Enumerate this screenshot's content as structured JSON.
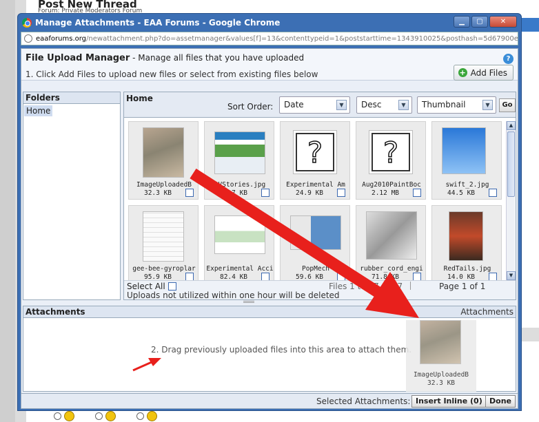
{
  "background_page": {
    "title": "Post New Thread",
    "subtitle": "Forum: Private Moderators Forum"
  },
  "window": {
    "title": "Manage Attachments - EAA Forums - Google Chrome",
    "url_host": "eaaforums.org",
    "url_path": "/newattachment.php?do=assetmanager&values[f]=13&contenttypeid=1&poststarttime=1343910025&posthash=5d67900ea59ba"
  },
  "header": {
    "title": "File Upload Manager",
    "subtitle": "- Manage all files that you have uploaded",
    "instruction": "1. Click Add Files to upload new files or select from existing files below",
    "help": "?",
    "add_files_label": "Add Files"
  },
  "folders": {
    "heading": "Folders",
    "items": [
      "Home"
    ]
  },
  "file_area": {
    "breadcrumb": "Home",
    "sort_label": "Sort Order:",
    "sort_field": "Date",
    "sort_dir": "Desc",
    "view_mode": "Thumbnail",
    "go_label": "Go",
    "files": [
      {
        "name": "ImageUploadedB",
        "size": "32.3 KB"
      },
      {
        "name": "RVStories.jpg",
        "size": "54.7 KB"
      },
      {
        "name": "Experimental Am",
        "size": "24.9 KB"
      },
      {
        "name": "Aug2010PaintBoc",
        "size": "2.12 MB"
      },
      {
        "name": "swift_2.jpg",
        "size": "44.5 KB"
      },
      {
        "name": "gee-bee-gyroplar",
        "size": "95.9 KB"
      },
      {
        "name": "Experimental Acci",
        "size": "82.4 KB"
      },
      {
        "name": "PopMech",
        "size": "59.6 KB"
      },
      {
        "name": "rubber_cord_engi",
        "size": "71.8 KB"
      },
      {
        "name": "RedTails.jpg",
        "size": "14.0 KB"
      }
    ],
    "select_all": "Select All",
    "files_count": "Files 1 to 17 of 17",
    "page_info": "Page 1 of 1",
    "uploads_note": "Uploads not utilized within one hour will be deleted"
  },
  "attachments": {
    "heading": "Attachments",
    "right_label": "Attachments",
    "drag_hint": "2. Drag previously uploaded files into this area to attach them.",
    "dragged_file": {
      "name": "ImageUploadedB",
      "size": "32.3 KB"
    }
  },
  "footer": {
    "selected_label": "Selected Attachments:",
    "insert_label": "Insert Inline (0)",
    "done_label": "Done"
  },
  "colors": {
    "titlebar": "#3c6fb4",
    "arrow": "#e8201c",
    "panel_head": "#dde5f1"
  }
}
